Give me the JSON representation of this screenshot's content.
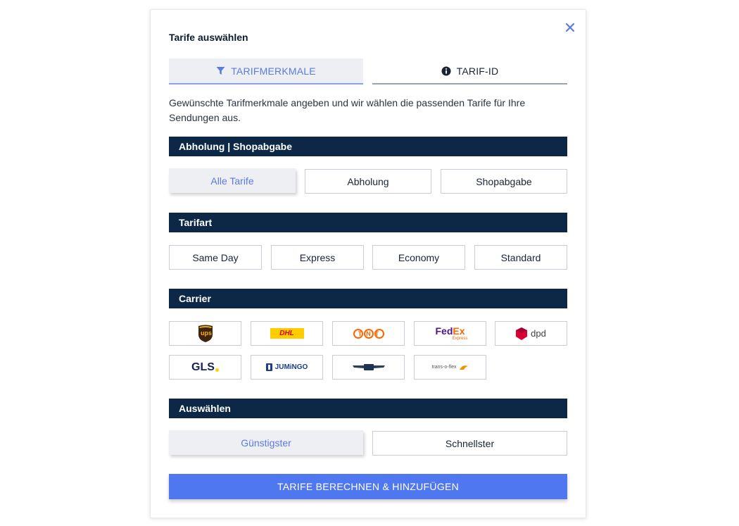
{
  "dialog": {
    "title": "Tarife auswählen"
  },
  "tabs": [
    {
      "label": "TARIFMERKMALE",
      "icon": "filter-icon",
      "active": true
    },
    {
      "label": "TARIF-ID",
      "icon": "info-icon",
      "active": false
    }
  ],
  "intro_text": "Gewünschte Tarifmerkmale angeben und wir wählen die passenden Tarife für Ihre Sendungen aus.",
  "pickup": {
    "header": "Abholung | Shopabgabe",
    "options": [
      "Alle Tarife",
      "Abholung",
      "Shopabgabe"
    ],
    "selected": "Alle Tarife"
  },
  "tariff_type": {
    "header": "Tarifart",
    "options": [
      "Same Day",
      "Express",
      "Economy",
      "Standard"
    ]
  },
  "carrier": {
    "header": "Carrier",
    "logos": {
      "ups": "ups",
      "dhl": "DHL",
      "tnt": "TNT",
      "fedex_a": "Fed",
      "fedex_b": "Ex",
      "fedex_sub": "Express",
      "dpd": "dpd",
      "gls": "GLS",
      "jumingo": "JUMiNGO",
      "transoflex": "trans-o-flex"
    }
  },
  "select": {
    "header": "Auswählen",
    "options": [
      "Günstigster",
      "Schnellster"
    ],
    "selected": "Günstigster"
  },
  "cta_label": "TARIFE BERECHNEN & HINZUFÜGEN",
  "colors": {
    "accent": "#4f78f0",
    "navy": "#0c2846",
    "selected_bg": "#eeeff2",
    "selected_text": "#5a7be0"
  }
}
